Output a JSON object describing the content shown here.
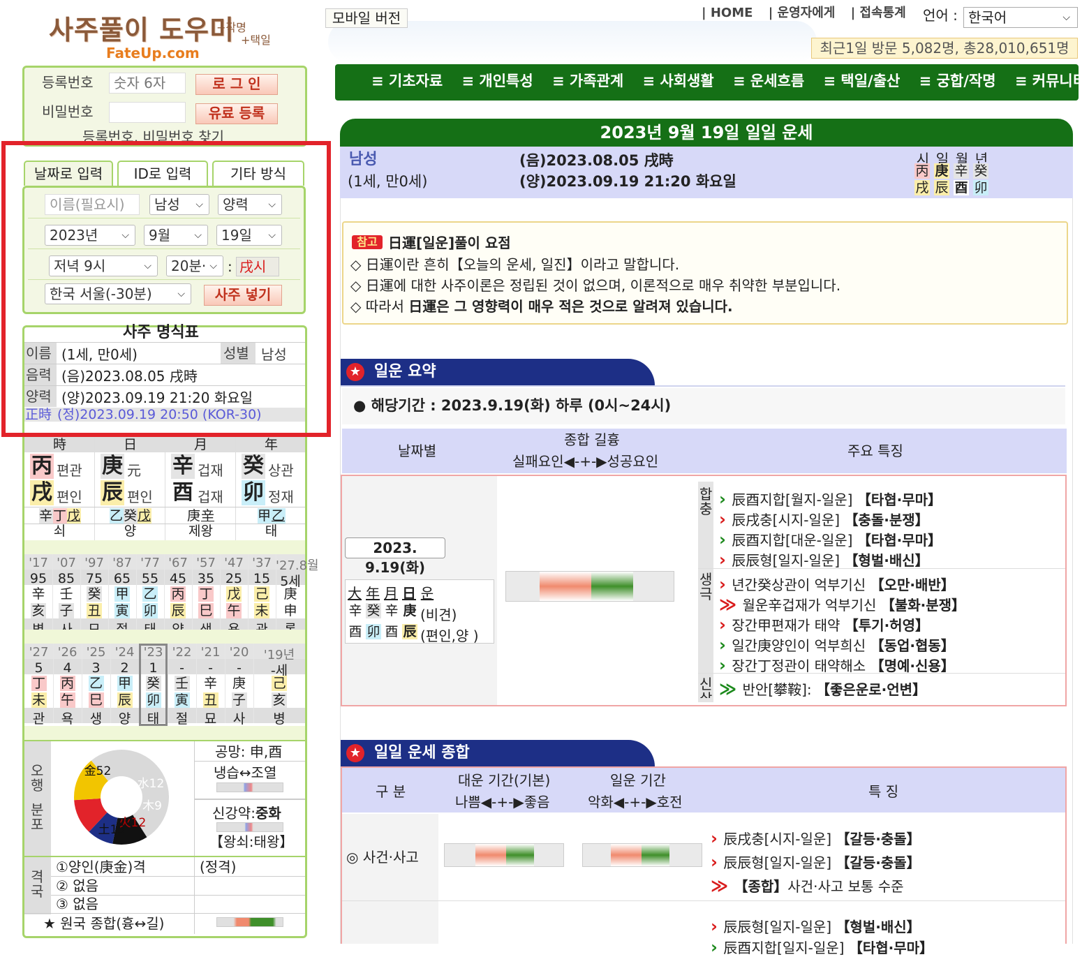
{
  "header": {
    "logo_main": "사주풀이 도우미",
    "logo_sub1": "+작명",
    "logo_sub2": "+택일",
    "logo_url": "FateUp.com",
    "mobile_btn": "모바일 버전",
    "top_links": [
      "| HOME",
      "| 운영자에게",
      "| 접속통계"
    ],
    "lang_label": "언어 :",
    "lang_value": "한국어",
    "visit_stats": "최근1일 방문 5,082명, 총28,010,651명"
  },
  "main_nav": [
    "≡ 기초자료",
    "≡ 개인특성",
    "≡ 가족관계",
    "≡ 사회생활",
    "≡ 운세흐름",
    "≡ 택일/출산",
    "≡ 궁합/작명",
    "≡ 커뮤니티"
  ],
  "login": {
    "id_label": "등록번호",
    "id_placeholder": "숫자 6자",
    "pw_label": "비밀번호",
    "login_btn": "로 그 인",
    "register_btn": "유료 등록",
    "find_link": "등록번호, 비밀번호 찾기"
  },
  "input_tabs": [
    "날짜로 입력",
    "ID로 입력",
    "기타 방식"
  ],
  "input_form": {
    "name_placeholder": "이름(필요시)",
    "gender": "남성",
    "calendar": "양력",
    "year": "2023년",
    "month": "9월",
    "day": "19일",
    "hour": "저녁 9시",
    "minute": "20분·",
    "colon": ":",
    "hour_branch": "戌시",
    "location": "한국 서울(-30분)",
    "submit_btn": "사주 넣기"
  },
  "myeongsik": {
    "title": "사주 명식표",
    "name_label": "이름",
    "name_value": "(1세, 만0세)",
    "gender_label": "성별",
    "gender_value": "남성",
    "lunar_label": "음력",
    "lunar_value": "(음)2023.08.05 戌時",
    "solar_label": "양력",
    "solar_value": "(양)2023.09.19 21:20 화요일",
    "jeongsi_label": "正時",
    "jeongsi_value": "(정)2023.09.19 20:50 (KOR-30)",
    "pillar_heads": [
      "時",
      "日",
      "月",
      "年"
    ],
    "stems": [
      {
        "char": "丙",
        "ten": "편관",
        "color": "#f9c9c9"
      },
      {
        "char": "庚",
        "ten": "元",
        "color": "#e4e4e4"
      },
      {
        "char": "辛",
        "ten": "겁재",
        "color": "#e4e4e4"
      },
      {
        "char": "癸",
        "ten": "상관",
        "color": "#e4e4e4"
      }
    ],
    "branches": [
      {
        "char": "戌",
        "ten": "편인",
        "color": "#fbeeaa"
      },
      {
        "char": "辰",
        "ten": "편인",
        "color": "#fbeeaa"
      },
      {
        "char": "酉",
        "ten": "겁재",
        "color": "#ffffff"
      },
      {
        "char": "卯",
        "ten": "정재",
        "color": "#c9eef8"
      }
    ],
    "hidden": [
      [
        {
          "c": "辛",
          "bg": "#e4e4e4"
        },
        {
          "c": "丁",
          "bg": "#f9c9c9"
        },
        {
          "c": "戊",
          "bg": "#fbeeaa",
          "u": true
        }
      ],
      [
        {
          "c": "乙",
          "bg": "#c9eef8"
        },
        {
          "c": "癸",
          "bg": "#e4e4e4"
        },
        {
          "c": "戊",
          "bg": "#fbeeaa",
          "u": true
        }
      ],
      [
        {
          "c": "庚",
          "bg": "#ffffff"
        },
        {
          "c": "辛",
          "bg": "#ffffff",
          "u": true
        }
      ],
      [
        {
          "c": "甲",
          "bg": "#c9eef8"
        },
        {
          "c": "乙",
          "bg": "#c9eef8",
          "u": true
        }
      ]
    ],
    "stages": [
      "쇠",
      "양",
      "제왕",
      "태"
    ],
    "daeun_years": [
      "'17",
      "'07",
      "'97",
      "'87",
      "'77",
      "'67",
      "'57",
      "'47",
      "'37",
      "'27.8월"
    ],
    "daeun_ages": [
      "95",
      "85",
      "75",
      "65",
      "55",
      "45",
      "35",
      "25",
      "15",
      "5세"
    ],
    "daeun_stems": [
      {
        "c": "辛",
        "bg": "#ffffff"
      },
      {
        "c": "壬",
        "bg": "#ffffff"
      },
      {
        "c": "癸",
        "bg": "#e4e4e4"
      },
      {
        "c": "甲",
        "bg": "#c9eef8"
      },
      {
        "c": "乙",
        "bg": "#c9eef8"
      },
      {
        "c": "丙",
        "bg": "#f9c9c9"
      },
      {
        "c": "丁",
        "bg": "#f9c9c9"
      },
      {
        "c": "戊",
        "bg": "#fbeeaa"
      },
      {
        "c": "己",
        "bg": "#fbeeaa"
      },
      {
        "c": "庚",
        "bg": "#ffffff"
      }
    ],
    "daeun_branches": [
      {
        "c": "亥",
        "bg": "#e4e4e4"
      },
      {
        "c": "子",
        "bg": "#e4e4e4"
      },
      {
        "c": "丑",
        "bg": "#fbeeaa"
      },
      {
        "c": "寅",
        "bg": "#c9eef8"
      },
      {
        "c": "卯",
        "bg": "#c9eef8"
      },
      {
        "c": "辰",
        "bg": "#fbeeaa"
      },
      {
        "c": "巳",
        "bg": "#f9c9c9"
      },
      {
        "c": "午",
        "bg": "#f9c9c9"
      },
      {
        "c": "未",
        "bg": "#fbeeaa"
      },
      {
        "c": "申",
        "bg": "#ffffff"
      }
    ],
    "daeun_stages": [
      "병",
      "사",
      "묘",
      "절",
      "태",
      "양",
      "생",
      "욕",
      "관",
      "록"
    ],
    "seun_years": [
      "'27",
      "'26",
      "'25",
      "'24",
      "'23",
      "'22",
      "'21",
      "'20",
      "'19년"
    ],
    "seun_ages": [
      "5",
      "4",
      "3",
      "2",
      "1",
      "-",
      "-",
      "-",
      "-세"
    ],
    "seun_stems": [
      {
        "c": "丁",
        "bg": "#f9c9c9"
      },
      {
        "c": "丙",
        "bg": "#f9c9c9"
      },
      {
        "c": "乙",
        "bg": "#c9eef8"
      },
      {
        "c": "甲",
        "bg": "#c9eef8"
      },
      {
        "c": "癸",
        "bg": "#e4e4e4"
      },
      {
        "c": "壬",
        "bg": "#e4e4e4"
      },
      {
        "c": "辛",
        "bg": "#ffffff"
      },
      {
        "c": "庚",
        "bg": "#ffffff"
      },
      {
        "c": "己",
        "bg": "#fbeeaa"
      }
    ],
    "seun_branches": [
      {
        "c": "未",
        "bg": "#fbeeaa"
      },
      {
        "c": "午",
        "bg": "#f9c9c9"
      },
      {
        "c": "巳",
        "bg": "#f9c9c9"
      },
      {
        "c": "辰",
        "bg": "#fbeeaa"
      },
      {
        "c": "卯",
        "bg": "#c9eef8"
      },
      {
        "c": "寅",
        "bg": "#c9eef8"
      },
      {
        "c": "丑",
        "bg": "#fbeeaa"
      },
      {
        "c": "子",
        "bg": "#e4e4e4"
      },
      {
        "c": "亥",
        "bg": "#e4e4e4"
      }
    ],
    "seun_stages": [
      "관",
      "욕",
      "생",
      "양",
      "태",
      "절",
      "묘",
      "사",
      "병"
    ],
    "ohaeng_label": "오행",
    "bunpo_label": "분포",
    "chart_data": {
      "type": "pie",
      "labels": [
        "金52",
        "水12",
        "木9",
        "火12",
        "土15"
      ],
      "values": [
        52,
        12,
        9,
        12,
        15
      ],
      "colors": [
        "#d9d9d9",
        "#111111",
        "#1d2f86",
        "#e2232a",
        "#f2c500"
      ]
    },
    "gongmang": "공망: 申,酉",
    "naengseup": "냉습↔조열",
    "singang_prefix": "신강약:",
    "singang_value": "중화",
    "wangsoe": "【왕쇠:태왕】",
    "gyeokguk_label": "격국",
    "gyeok1": "①양인(庚金)격",
    "gyeok1_right": "(정격)",
    "gyeok2": "② 없음",
    "gyeok3": "③ 없음",
    "wonguk": "★ 원국 종합(흉↔길)"
  },
  "fortune": {
    "title": "2023년 9월 19일 일일 운세",
    "gender": "남성",
    "age": "(1세, 만0세)",
    "lunar": "(음)2023.08.05 戌時",
    "solar": "(양)2023.09.19 21:20 화요일",
    "pillar_heads": [
      "시",
      "일",
      "월",
      "년"
    ],
    "pillar_stems": [
      {
        "c": "丙",
        "bg": "#f9c9c9"
      },
      {
        "c": "庚",
        "bg": "#fbeeaa"
      },
      {
        "c": "辛",
        "bg": "#e4e4e4"
      },
      {
        "c": "癸",
        "bg": "#e4e4e4"
      }
    ],
    "pillar_branches": [
      {
        "c": "戌",
        "bg": "#fbeeaa"
      },
      {
        "c": "辰",
        "bg": "#fbeeaa"
      },
      {
        "c": "酉",
        "bg": "#ffffff"
      },
      {
        "c": "卯",
        "bg": "#c9eef8"
      }
    ]
  },
  "note": {
    "badge": "참고",
    "title": "日運[일운]풀이 요점",
    "lines": [
      "◇ 日運이란 흔히【오늘의 운세, 일진】이라고 말합니다.",
      "◇ 日運에 대한 사주이론은 정립된 것이 없으며, 이론적으로 매우 취약한 부분입니다."
    ],
    "line3_prefix": "◇ 따라서 ",
    "line3_bold": "日運은 그 영향력이 매우 적은 것으로 알려져 있습니다."
  },
  "summary": {
    "head": "일운 요약",
    "period": "● 해당기간 : 2023.9.19(화) 하루 (0시~24시)",
    "col_date": "날짜별",
    "col_total": "종합 길흉",
    "col_total_sub": "실패요인◀-+-▶성공요인",
    "col_feat": "주요 특징",
    "date_label": "2023. 9.19(화)",
    "daeun_head": [
      "大",
      "年",
      "月",
      "日",
      "운"
    ],
    "daeun_row1": [
      {
        "c": "辛",
        "bg": "#ffffff"
      },
      {
        "c": "癸",
        "bg": "#e4e4e4"
      },
      {
        "c": "辛",
        "bg": "#ffffff"
      },
      {
        "c": "庚",
        "bg": "#ffffff",
        "b": true
      }
    ],
    "daeun_row1_note": "(비견)",
    "daeun_row2": [
      {
        "c": "酉",
        "bg": "#ffffff"
      },
      {
        "c": "卯",
        "bg": "#c9eef8"
      },
      {
        "c": "酉",
        "bg": "#ffffff"
      },
      {
        "c": "辰",
        "bg": "#fbeeaa",
        "b": true
      }
    ],
    "daeun_row2_note": "(편인,양 )",
    "side1": "합충",
    "side2": "생극",
    "side3": "신살",
    "features_hapchung": [
      {
        "arrow": "green",
        "text": "辰酉지합[월지-일운] ",
        "bold": "【타협·무마】"
      },
      {
        "arrow": "red",
        "text": "辰戌충[시지-일운] ",
        "bold": "【충돌·분쟁】"
      },
      {
        "arrow": "green",
        "text": "辰酉지합[대운-일운] ",
        "bold": "【타협·무마】"
      },
      {
        "arrow": "red",
        "text": "辰辰형[일지-일운] ",
        "bold": "【형벌·배신】"
      }
    ],
    "features_saenggeuk": [
      {
        "arrow": "red",
        "text": "년간癸상관이 억부기신 ",
        "bold": "【오만·배반】"
      },
      {
        "arrow": "red2",
        "text": "월운辛겁재가 억부기신 ",
        "bold": "【불화·분쟁】"
      },
      {
        "arrow": "red",
        "text": "장간甲편재가 태약 ",
        "bold": "【투기·허영】"
      },
      {
        "arrow": "green",
        "text": "일간庚양인이 억부희신 ",
        "bold": "【동업·협동】"
      },
      {
        "arrow": "green",
        "text": "장간丁정관이 태약해소 ",
        "bold": "【명예·신용】"
      }
    ],
    "features_sinsal": [
      {
        "arrow": "green2",
        "text": "반안[攀鞍]: ",
        "bold": "【좋은운로·언변】"
      }
    ]
  },
  "daily": {
    "head": "일일 운세 종합",
    "col_gubun": "구 분",
    "col_daeun": "대운 기간(기본)",
    "col_daeun_sub": "나쁨◀-+-▶좋음",
    "col_ilun": "일운 기간",
    "col_ilun_sub": "악화◀-+-▶호전",
    "col_feat": "특 징",
    "row1_label": "◎ 사건·사고",
    "row1_feats": [
      {
        "arrow": "red",
        "text": "辰戌충[시지-일운] ",
        "bold": "【갈등·충돌】"
      },
      {
        "arrow": "red",
        "text": "辰辰형[일지-일운] ",
        "bold": "【갈등·충돌】"
      },
      {
        "arrow": "red2",
        "bold": "【종합】",
        "text": "사건·사고 보통 수준"
      }
    ],
    "row2_feats": [
      {
        "arrow": "red",
        "text": "辰辰형[일지-일운] ",
        "bold": "【형벌·배신】"
      },
      {
        "arrow": "green",
        "text": "辰酉지합[일지-일운] ",
        "bold": "【타협·무마】"
      }
    ]
  }
}
